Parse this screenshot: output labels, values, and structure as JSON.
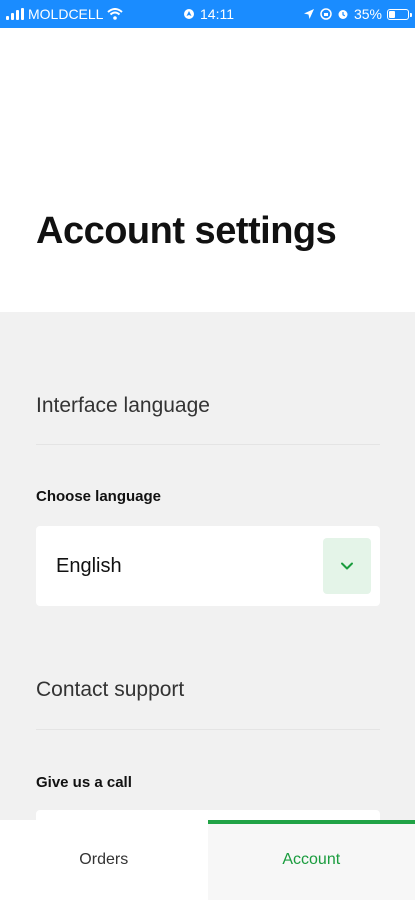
{
  "status_bar": {
    "carrier": "MOLDCELL",
    "time": "14:11",
    "battery": "35%",
    "battery_level": 0.35
  },
  "header": {
    "title": "Account settings"
  },
  "interface_language": {
    "section_title": "Interface language",
    "field_label": "Choose language",
    "selected_value": "English"
  },
  "contact_support": {
    "section_title": "Contact support",
    "field_label": "Give us a call"
  },
  "bottom_nav": {
    "tabs": [
      {
        "label": "Orders"
      },
      {
        "label": "Account"
      }
    ],
    "active_tab": "Account"
  },
  "colors": {
    "status_bar": "#1a8cff",
    "accent_green": "#21a346",
    "content_background": "#f1f1f1"
  }
}
